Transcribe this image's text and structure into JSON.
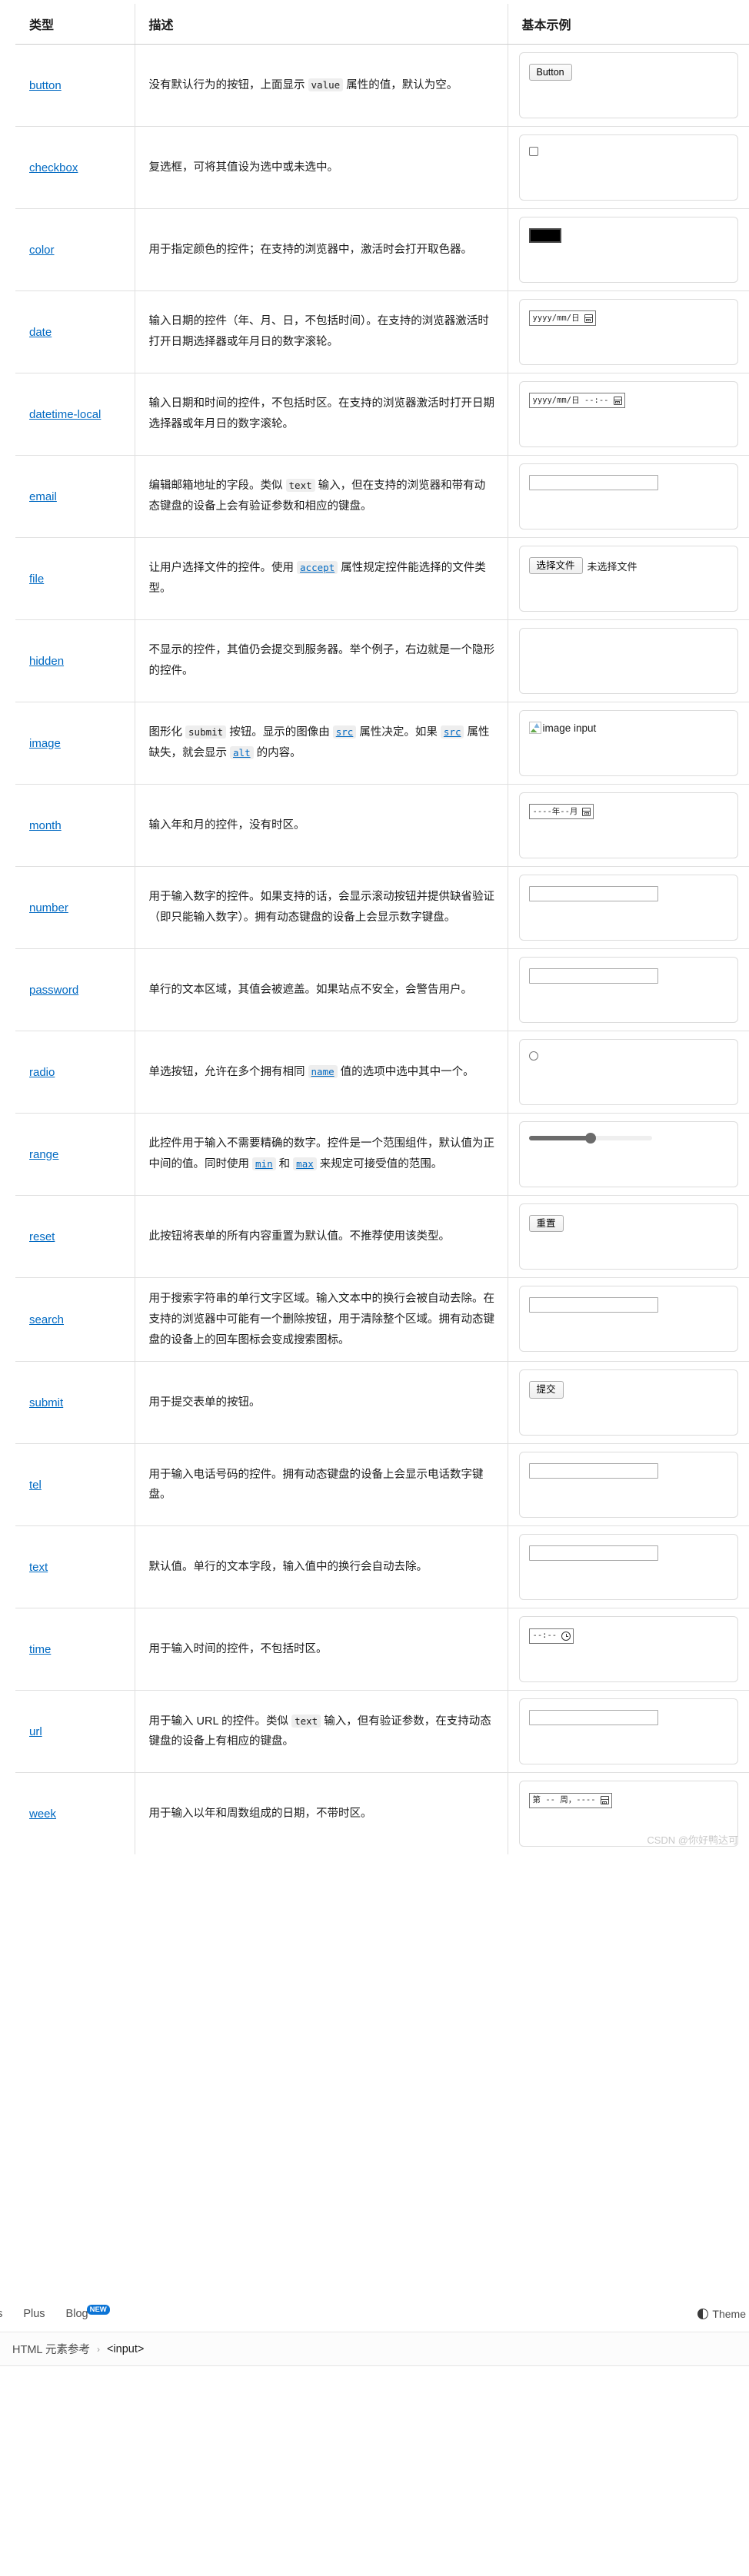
{
  "table": {
    "headers": [
      "类型",
      "描述",
      "基本示例"
    ],
    "rows": [
      {
        "type": "button",
        "desc_parts": [
          {
            "t": "text",
            "v": "没有默认行为的按钮，上面显示 "
          },
          {
            "t": "code",
            "v": "value"
          },
          {
            "t": "text",
            "v": " 属性的值，默认为空。"
          }
        ],
        "example": "button"
      },
      {
        "type": "checkbox",
        "desc_parts": [
          {
            "t": "text",
            "v": "复选框，可将其值设为选中或未选中。"
          }
        ],
        "example": "checkbox"
      },
      {
        "type": "color",
        "desc_parts": [
          {
            "t": "text",
            "v": "用于指定颜色的控件；在支持的浏览器中，激活时会打开取色器。"
          }
        ],
        "example": "color"
      },
      {
        "type": "date",
        "desc_parts": [
          {
            "t": "text",
            "v": "输入日期的控件（年、月、日，不包括时间）。在支持的浏览器激活时打开日期选择器或年月日的数字滚轮。"
          }
        ],
        "example": "date"
      },
      {
        "type": "datetime-local",
        "desc_parts": [
          {
            "t": "text",
            "v": "输入日期和时间的控件，不包括时区。在支持的浏览器激活时打开日期选择器或年月日的数字滚轮。"
          }
        ],
        "example": "datetime-local"
      },
      {
        "type": "email",
        "desc_parts": [
          {
            "t": "text",
            "v": "编辑邮箱地址的字段。类似 "
          },
          {
            "t": "code",
            "v": "text"
          },
          {
            "t": "text",
            "v": " 输入，但在支持的浏览器和带有动态键盘的设备上会有验证参数和相应的键盘。"
          }
        ],
        "example": "textbox"
      },
      {
        "type": "file",
        "desc_parts": [
          {
            "t": "text",
            "v": "让用户选择文件的控件。使用 "
          },
          {
            "t": "codelink",
            "v": "accept"
          },
          {
            "t": "text",
            "v": " 属性规定控件能选择的文件类型。"
          }
        ],
        "example": "file"
      },
      {
        "type": "hidden",
        "desc_parts": [
          {
            "t": "text",
            "v": "不显示的控件，其值仍会提交到服务器。举个例子，右边就是一个隐形的控件。"
          }
        ],
        "example": "empty"
      },
      {
        "type": "image",
        "desc_parts": [
          {
            "t": "text",
            "v": "图形化 "
          },
          {
            "t": "code",
            "v": "submit"
          },
          {
            "t": "text",
            "v": " 按钮。显示的图像由 "
          },
          {
            "t": "codelink",
            "v": "src"
          },
          {
            "t": "text",
            "v": " 属性决定。如果 "
          },
          {
            "t": "codelink",
            "v": "src"
          },
          {
            "t": "text",
            "v": " 属性缺失，就会显示 "
          },
          {
            "t": "codelink",
            "v": "alt"
          },
          {
            "t": "text",
            "v": " 的内容。"
          }
        ],
        "example": "image"
      },
      {
        "type": "month",
        "desc_parts": [
          {
            "t": "text",
            "v": "输入年和月的控件，没有时区。"
          }
        ],
        "example": "month"
      },
      {
        "type": "number",
        "desc_parts": [
          {
            "t": "text",
            "v": "用于输入数字的控件。如果支持的话，会显示滚动按钮并提供缺省验证（即只能输入数字）。拥有动态键盘的设备上会显示数字键盘。"
          }
        ],
        "example": "textbox"
      },
      {
        "type": "password",
        "desc_parts": [
          {
            "t": "text",
            "v": "单行的文本区域，其值会被遮盖。如果站点不安全，会警告用户。"
          }
        ],
        "example": "textbox"
      },
      {
        "type": "radio",
        "desc_parts": [
          {
            "t": "text",
            "v": "单选按钮，允许在多个拥有相同 "
          },
          {
            "t": "codelink",
            "v": "name"
          },
          {
            "t": "text",
            "v": " 值的选项中选中其中一个。"
          }
        ],
        "example": "radio"
      },
      {
        "type": "range",
        "desc_parts": [
          {
            "t": "text",
            "v": "此控件用于输入不需要精确的数字。控件是一个范围组件，默认值为正中间的值。同时使用 "
          },
          {
            "t": "codelink",
            "v": "min"
          },
          {
            "t": "text",
            "v": " 和 "
          },
          {
            "t": "codelink",
            "v": "max"
          },
          {
            "t": "text",
            "v": " 来规定可接受值的范围。"
          }
        ],
        "example": "range"
      },
      {
        "type": "reset",
        "desc_parts": [
          {
            "t": "text",
            "v": "此按钮将表单的所有内容重置为默认值。不推荐使用该类型。"
          }
        ],
        "example": "reset"
      },
      {
        "type": "search",
        "desc_parts": [
          {
            "t": "text",
            "v": "用于搜索字符串的单行文字区域。输入文本中的换行会被自动去除。在支持的浏览器中可能有一个删除按钮，用于清除整个区域。拥有动态键盘的设备上的回车图标会变成搜索图标。"
          }
        ],
        "example": "textbox"
      },
      {
        "type": "submit",
        "desc_parts": [
          {
            "t": "text",
            "v": "用于提交表单的按钮。"
          }
        ],
        "example": "submit"
      },
      {
        "type": "tel",
        "desc_parts": [
          {
            "t": "text",
            "v": "用于输入电话号码的控件。拥有动态键盘的设备上会显示电话数字键盘。"
          }
        ],
        "example": "textbox"
      },
      {
        "type": "text",
        "desc_parts": [
          {
            "t": "text",
            "v": "默认值。单行的文本字段，输入值中的换行会自动去除。"
          }
        ],
        "example": "textbox"
      },
      {
        "type": "time",
        "desc_parts": [
          {
            "t": "text",
            "v": "用于输入时间的控件，不包括时区。"
          }
        ],
        "example": "time"
      },
      {
        "type": "url",
        "desc_parts": [
          {
            "t": "text",
            "v": "用于输入 URL 的控件。类似 "
          },
          {
            "t": "code",
            "v": "text"
          },
          {
            "t": "text",
            "v": " 输入，但有验证参数，在支持动态键盘的设备上有相应的键盘。"
          }
        ],
        "example": "textbox"
      },
      {
        "type": "week",
        "desc_parts": [
          {
            "t": "text",
            "v": "用于输入以年和周数组成的日期，不带时区。"
          }
        ],
        "example": "week"
      }
    ]
  },
  "widgets": {
    "button_label": "Button",
    "reset_label": "重置",
    "submit_label": "提交",
    "file_button_label": "选择文件",
    "file_status": "未选择文件",
    "image_alt": "image input",
    "color_value": "#000000",
    "date_placeholder": "yyyy/mm/日",
    "datetime_placeholder": "yyyy/mm/日 --:--",
    "month_placeholder": "----年--月",
    "time_placeholder": "--:--",
    "week_placeholder": "第 -- 周，----",
    "range_value": 50
  },
  "nav": {
    "items": [
      {
        "label": "es",
        "badge": ""
      },
      {
        "label": "Plus",
        "badge": ""
      },
      {
        "label": "Blog",
        "badge": "NEW"
      }
    ],
    "theme_label": "Theme"
  },
  "breadcrumb": {
    "parent": "HTML 元素参考",
    "separator": "›",
    "current": "<input>"
  },
  "watermark": "CSDN @你好鸭达可",
  "colors": {
    "link": "#0069c2",
    "badge": "#0b74d6",
    "border": "#e0e0e0",
    "code_bg": "#eeeeee"
  }
}
